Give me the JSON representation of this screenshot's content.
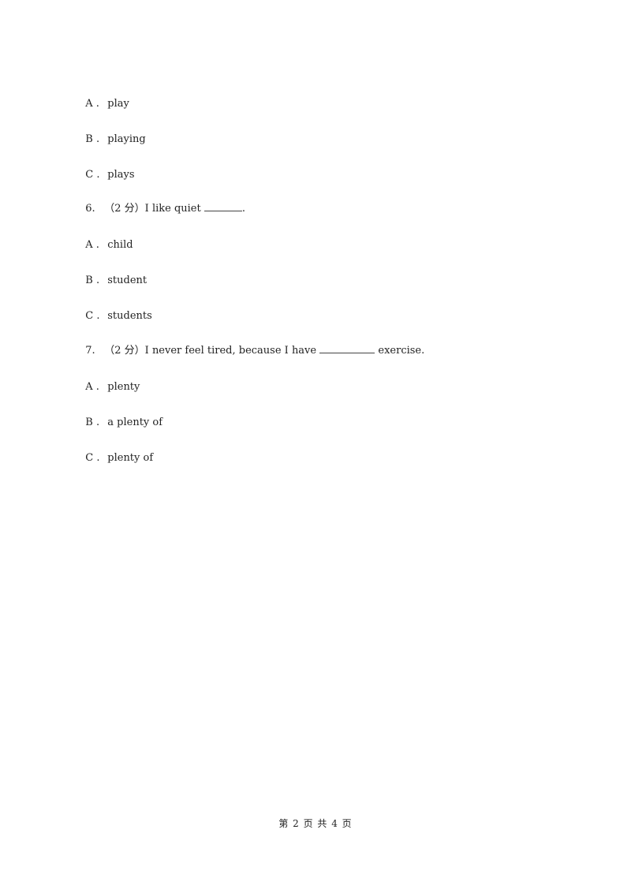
{
  "questions": [
    {
      "number": "",
      "prompt": "",
      "options": [
        {
          "letter": "A .",
          "text": "play"
        },
        {
          "letter": "B .",
          "text": "playing"
        },
        {
          "letter": "C .",
          "text": "plays"
        }
      ]
    },
    {
      "number": "6.",
      "score": "（2 分）",
      "prompt_before": "I like quiet",
      "prompt_after": ".",
      "options": [
        {
          "letter": "A .",
          "text": "child"
        },
        {
          "letter": "B .",
          "text": "student"
        },
        {
          "letter": "C .",
          "text": "students"
        }
      ]
    },
    {
      "number": "7.",
      "score": "（2 分）",
      "prompt_before": "I never feel tired, because I have",
      "prompt_after": "exercise.",
      "options": [
        {
          "letter": "A .",
          "text": "plenty"
        },
        {
          "letter": "B .",
          "text": "a plenty of"
        },
        {
          "letter": "C .",
          "text": "plenty of"
        }
      ]
    }
  ],
  "footer": {
    "page_text": "第 2 页 共 4 页"
  }
}
